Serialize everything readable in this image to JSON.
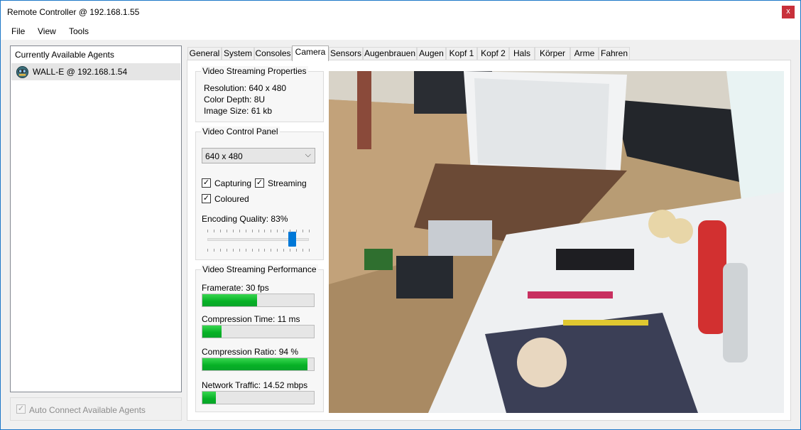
{
  "window": {
    "title": "Remote Controller @ 192.168.1.55",
    "close_label": "x"
  },
  "menu": {
    "items": [
      "File",
      "View",
      "Tools"
    ]
  },
  "agents": {
    "header": "Currently Available Agents",
    "items": [
      {
        "label": "WALL-E @ 192.168.1.54",
        "icon": "robot-icon"
      }
    ],
    "auto_connect": {
      "label": "Auto Connect Available Agents",
      "checked": true,
      "enabled": false
    }
  },
  "tabs": [
    "General",
    "System",
    "Consoles",
    "Camera",
    "Sensors",
    "Augenbrauen",
    "Augen",
    "Kopf 1",
    "Kopf 2",
    "Hals",
    "Körper",
    "Arme",
    "Fahren"
  ],
  "active_tab": "Camera",
  "streaming_properties": {
    "title": "Video Streaming Properties",
    "resolution": "Resolution: 640 x 480",
    "color_depth": "Color Depth: 8U",
    "image_size": "Image Size: 61 kb"
  },
  "control_panel": {
    "title": "Video Control Panel",
    "resolution_select": "640 x 480",
    "capturing": {
      "label": "Capturing",
      "checked": true
    },
    "streaming": {
      "label": "Streaming",
      "checked": true
    },
    "coloured": {
      "label": "Coloured",
      "checked": true
    },
    "quality_label": "Encoding Quality: 83%",
    "quality_value": 83
  },
  "performance": {
    "title": "Video Streaming Performance",
    "framerate": {
      "label": "Framerate: 30 fps",
      "fraction": 0.49
    },
    "compression_time": {
      "label": "Compression Time: 11 ms",
      "fraction": 0.17
    },
    "compression_ratio": {
      "label": "Compression Ratio: 94 %",
      "fraction": 0.94
    },
    "network_traffic": {
      "label": "Network Traffic: 14.52 mbps",
      "fraction": 0.12
    }
  },
  "colors": {
    "accent": "#0078d7",
    "progress_green": "#06b025",
    "close_red": "#c8303a"
  }
}
